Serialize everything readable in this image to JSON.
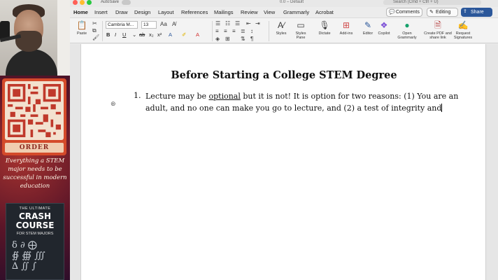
{
  "word": {
    "title_bar": {
      "autosave": "AutoSave",
      "document_name": "0.0 – Default",
      "search_placeholder": "Search (Cmd + Ctrl + U)"
    },
    "tabs": [
      "Home",
      "Insert",
      "Draw",
      "Design",
      "Layout",
      "References",
      "Mailings",
      "Review",
      "View",
      "Grammarly",
      "Acrobat"
    ],
    "active_tab": "Home",
    "top_buttons": {
      "comments": "Comments",
      "editing": "Editing",
      "share": "Share"
    },
    "ribbon": {
      "paste": "Paste",
      "font_name": "Cambria M...",
      "font_size": "13",
      "styles": "Styles",
      "styles_pane": "Styles Pane",
      "dictate": "Dictate",
      "addins": "Add-ins",
      "editor": "Editor",
      "copilot": "Copilot",
      "open_grammarly": "Open Grammarly",
      "create_pdf": "Create PDF and share link",
      "request_signatures": "Request Signatures"
    },
    "document": {
      "heading": "Before Starting a College STEM Degree",
      "list_number": "1.",
      "list_text_before": "Lecture may be ",
      "list_text_underlined": "optional",
      "list_text_after": " but it is not! It is option for two reasons: (1) You are an adult, and no one can make you go to lecture, and (2) a test of integrity and"
    }
  },
  "promo": {
    "order_label": "ORDER",
    "tagline": "Everything a STEM major needs to be successful in modern education",
    "book": {
      "top": "THE ULTIMATE",
      "title": "CRASH COURSE",
      "subtitle": "FOR STEM MAJORS"
    }
  },
  "colors": {
    "accent": "#2b579a",
    "promo_bg": "#5a1528",
    "qr_card": "#d44a2a"
  }
}
